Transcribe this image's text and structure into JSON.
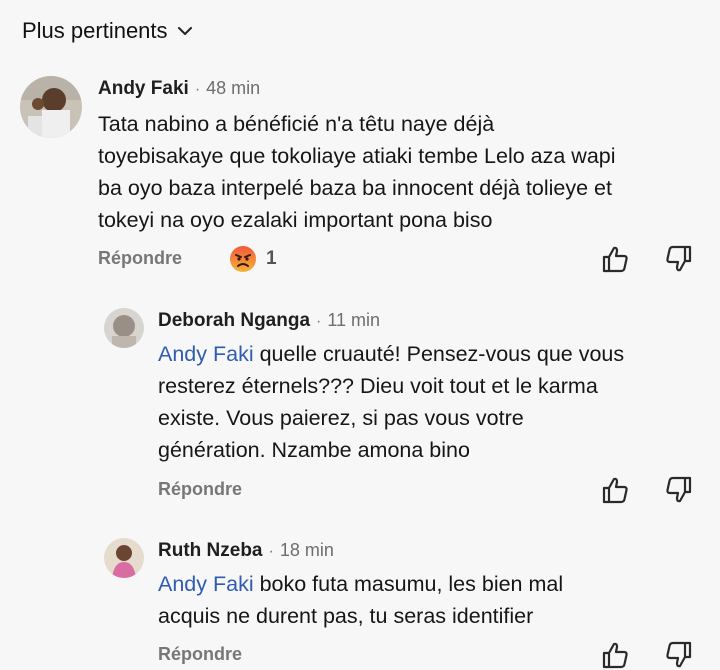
{
  "sort": {
    "label": "Plus pertinents",
    "icon": "chevron-down-icon"
  },
  "comments": [
    {
      "author": "Andy Faki",
      "separator": "·",
      "time": "48 min",
      "lines": [
        "Tata nabino a bénéficié n'a têtu naye déjà",
        "toyebisakaye que tokoliaye atiaki tembe Lelo aza wapi",
        "ba oyo baza interpelé baza ba innocent déjà tolieye et",
        "tokeyi na oyo ezalaki important pona biso"
      ],
      "reply_label": "Répondre",
      "reaction": {
        "icon": "angry-face-icon",
        "count": "1"
      }
    },
    {
      "author": "Deborah Nganga",
      "separator": "·",
      "time": "11 min",
      "mention": "Andy Faki",
      "first_line_rest": " quelle cruauté! Pensez-vous que vous",
      "lines": [
        "resterez éternels??? Dieu voit tout  et le karma",
        "existe. Vous paierez, si pas vous votre",
        "génération. Nzambe amona bino"
      ],
      "reply_label": "Répondre"
    },
    {
      "author": "Ruth Nzeba",
      "separator": "·",
      "time": "18 min",
      "mention": "Andy Faki",
      "first_line_rest": " boko futa masumu, les bien mal",
      "lines": [
        "acquis ne durent pas, tu seras identifier"
      ],
      "reply_label": "Répondre"
    }
  ]
}
